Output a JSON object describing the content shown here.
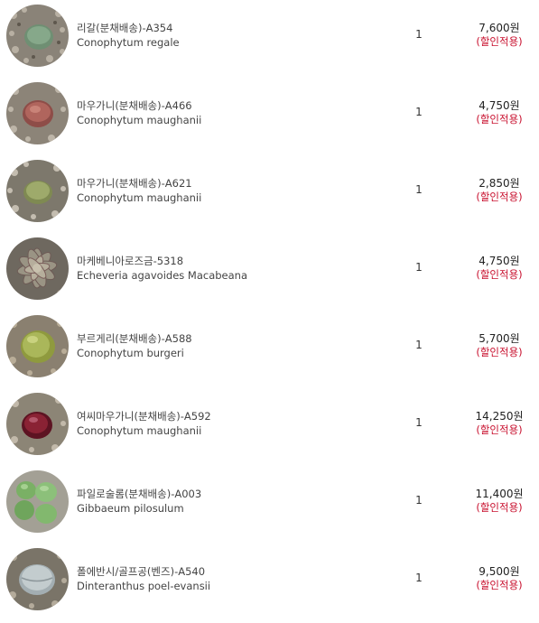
{
  "items": [
    {
      "name": "리갈(분채배송)-A354",
      "scientific": "Conophytum regale",
      "quantity": "1",
      "price": "7,600원",
      "discount": "(할인적용)",
      "plant_color": "#6f8f73"
    },
    {
      "name": "마우가니(분채배송)-A466",
      "scientific": "Conophytum maughanii",
      "quantity": "1",
      "price": "4,750원",
      "discount": "(할인적용)",
      "plant_color": "#a2584f"
    },
    {
      "name": "마우가니(분채배송)-A621",
      "scientific": "Conophytum maughanii",
      "quantity": "1",
      "price": "2,850원",
      "discount": "(할인적용)",
      "plant_color": "#8f9a5e"
    },
    {
      "name": "마케베니아로즈금-5318",
      "scientific": "Echeveria agavoides Macabeana",
      "quantity": "1",
      "price": "4,750원",
      "discount": "(할인적용)",
      "plant_color": "#8f8a7a"
    },
    {
      "name": "부르게리(분채배송)-A588",
      "scientific": "Conophytum burgeri",
      "quantity": "1",
      "price": "5,700원",
      "discount": "(할인적용)",
      "plant_color": "#9aa84a"
    },
    {
      "name": "여씨마우가니(분채배송)-A592",
      "scientific": "Conophytum maughanii",
      "quantity": "1",
      "price": "14,250원",
      "discount": "(할인적용)",
      "plant_color": "#7a1f2e"
    },
    {
      "name": "파일로술롬(분채배송)-A003",
      "scientific": "Gibbaeum pilosulum",
      "quantity": "1",
      "price": "11,400원",
      "discount": "(할인적용)",
      "plant_color": "#7fb36a"
    },
    {
      "name": "폴에반시/골프공(벤즈)-A540",
      "scientific": "Dinteranthus poel-evansii",
      "quantity": "1",
      "price": "9,500원",
      "discount": "(할인적용)",
      "plant_color": "#b9c3c6"
    }
  ]
}
